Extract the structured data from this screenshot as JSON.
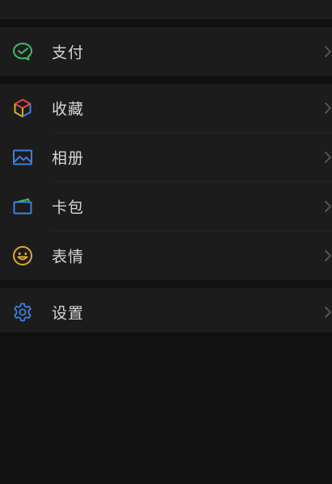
{
  "menu": {
    "pay": {
      "label": "支付",
      "icon": "wechat-pay-icon"
    },
    "favorites": {
      "label": "收藏",
      "icon": "cube-icon"
    },
    "album": {
      "label": "相册",
      "icon": "image-icon"
    },
    "cards": {
      "label": "卡包",
      "icon": "wallet-icon"
    },
    "stickers": {
      "label": "表情",
      "icon": "smiley-icon"
    },
    "settings": {
      "label": "设置",
      "icon": "gear-icon"
    }
  },
  "colors": {
    "background": "#111111",
    "row_background": "#1c1c1c",
    "text": "#d6d6d6",
    "chevron": "#5a5a5a",
    "pay_green": "#3fba6a",
    "gear_blue": "#3d7fe0",
    "smiley_yellow": "#e0a92e"
  }
}
